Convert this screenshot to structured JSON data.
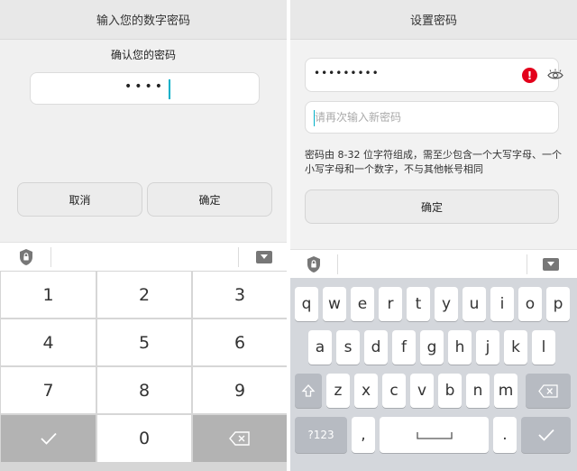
{
  "left": {
    "title": "输入您的数字密码",
    "confirm_label": "确认您的密码",
    "pin_mask": "••••",
    "cancel_label": "取消",
    "ok_label": "确定",
    "numpad": {
      "keys": [
        "1",
        "2",
        "3",
        "4",
        "5",
        "6",
        "7",
        "8",
        "9",
        "0"
      ]
    }
  },
  "right": {
    "title": "设置密码",
    "password_mask": "•••••••••",
    "error_glyph": "!",
    "confirm_placeholder": "请再次输入新密码",
    "hint": "密码由 8-32 位字符组成，需至少包含一个大写字母、一个小写字母和一个数字，不与其他帐号相同",
    "ok_label": "确定",
    "keyboard": {
      "row1": [
        "q",
        "w",
        "e",
        "r",
        "t",
        "y",
        "u",
        "i",
        "o",
        "p"
      ],
      "row2": [
        "a",
        "s",
        "d",
        "f",
        "g",
        "h",
        "j",
        "k",
        "l"
      ],
      "row3": [
        "z",
        "x",
        "c",
        "v",
        "b",
        "n",
        "m"
      ],
      "symbols_label": "?123",
      "comma": ",",
      "period": "."
    }
  },
  "icons": {
    "shield": "shield-icon",
    "collapse": "keyboard-collapse-icon",
    "check": "check-icon",
    "backspace": "backspace-icon",
    "shift": "shift-icon",
    "space": "space-icon",
    "eye": "eye-icon",
    "error": "error-icon"
  },
  "colors": {
    "accent_caret": "#00b0c8",
    "error_red": "#e3001b"
  }
}
